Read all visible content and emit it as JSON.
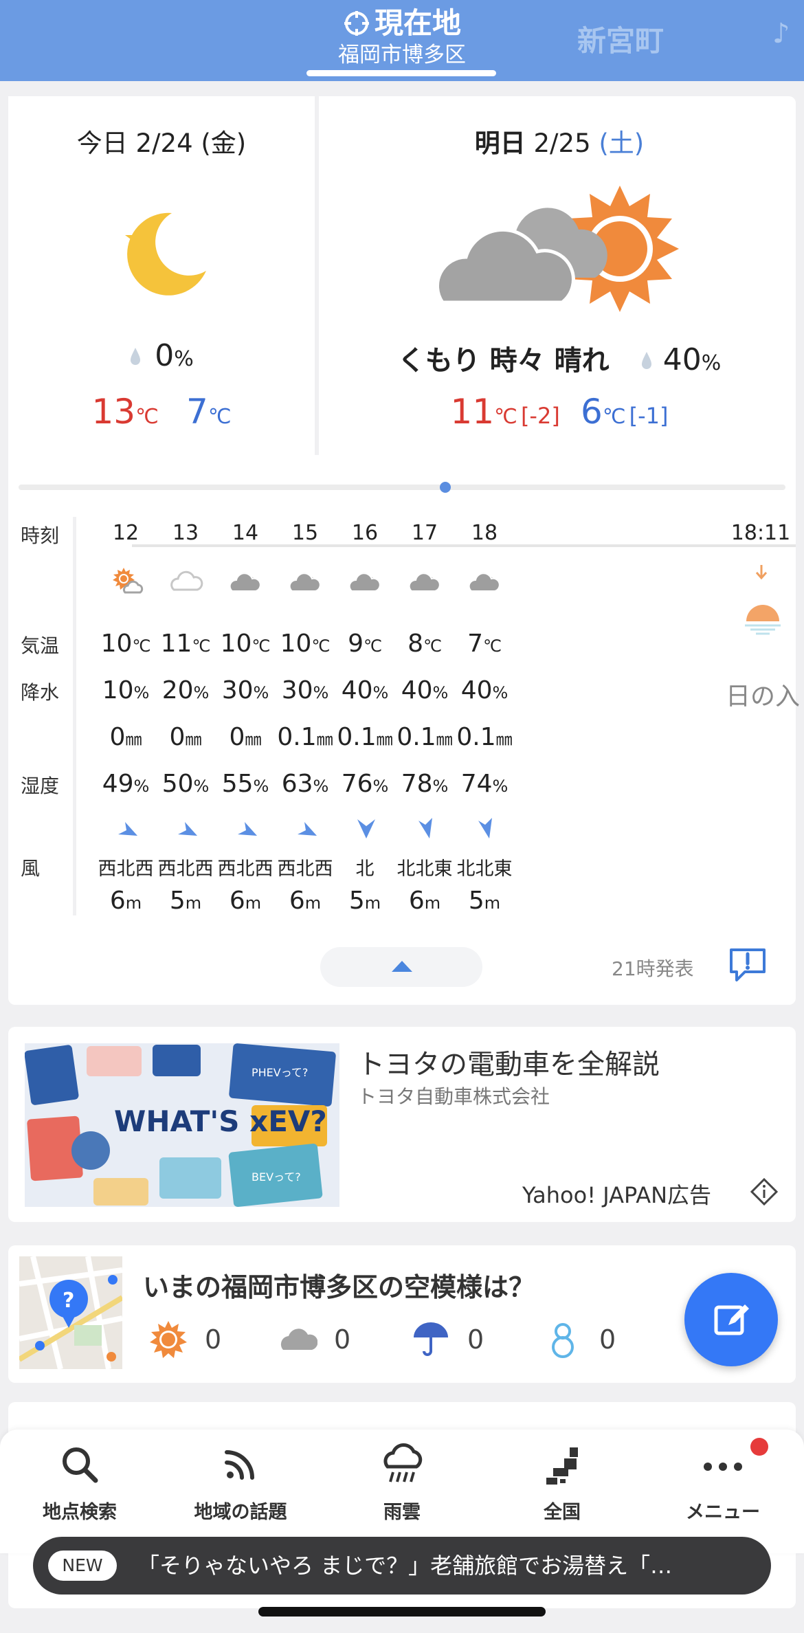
{
  "header": {
    "current_location_title": "現在地",
    "current_location_sub": "福岡市博多区",
    "other_location": "新宮町",
    "partial_tab": "♪"
  },
  "today": {
    "label": "今日",
    "date": "2/24",
    "weekday": "(金)",
    "icon": "moon-star-icon",
    "precip": "0",
    "precip_unit": "%",
    "high": "13",
    "low": "7",
    "temp_unit": "℃"
  },
  "tomorrow": {
    "label": "明日",
    "date": "2/25",
    "weekday": "(土)",
    "icon": "cloud-sun-icon",
    "weather_text": "くもり 時々 晴れ",
    "precip": "40",
    "precip_unit": "%",
    "high": "11",
    "high_diff": "[-2]",
    "low": "6",
    "low_diff": "[-1]",
    "temp_unit": "℃"
  },
  "hourly": {
    "labels": {
      "time": "時刻",
      "temp": "気温",
      "precip": "降水",
      "humidity": "湿度",
      "wind": "風"
    },
    "hours": [
      {
        "hour": "12",
        "icon": "sun-cloud-icon",
        "temp": "10",
        "prob": "10",
        "mm": "0",
        "hum": "49",
        "dir": "西北西",
        "spd": "6"
      },
      {
        "hour": "13",
        "icon": "light-cloud-icon",
        "temp": "11",
        "prob": "20",
        "mm": "0",
        "hum": "50",
        "dir": "西北西",
        "spd": "5"
      },
      {
        "hour": "14",
        "icon": "cloud-icon",
        "temp": "10",
        "prob": "30",
        "mm": "0",
        "hum": "55",
        "dir": "西北西",
        "spd": "6"
      },
      {
        "hour": "15",
        "icon": "cloud-icon",
        "temp": "10",
        "prob": "30",
        "mm": "0.1",
        "hum": "63",
        "dir": "西北西",
        "spd": "6"
      },
      {
        "hour": "16",
        "icon": "cloud-icon",
        "temp": "9",
        "prob": "40",
        "mm": "0.1",
        "hum": "76",
        "dir": "北",
        "spd": "5"
      },
      {
        "hour": "17",
        "icon": "cloud-icon",
        "temp": "8",
        "prob": "40",
        "mm": "0.1",
        "hum": "78",
        "dir": "北北東",
        "spd": "6"
      },
      {
        "hour": "18",
        "icon": "cloud-icon",
        "temp": "7",
        "prob": "40",
        "mm": "0.1",
        "hum": "74",
        "dir": "北北東",
        "spd": "5"
      }
    ],
    "units": {
      "temp": "℃",
      "prob": "%",
      "mm": "㎜",
      "hum": "%",
      "spd": "m"
    },
    "sunset": {
      "time": "18:11",
      "label": "日の入"
    },
    "issued": "21時発表"
  },
  "ad": {
    "title": "トヨタの電動車を全解説",
    "advertiser": "トヨタ自動車株式会社",
    "label": "Yahoo! JAPAN広告",
    "image_headline": "WHAT'S xEV?",
    "image_tag1": "PHEVって?",
    "image_tag2": "BEVって?"
  },
  "sky": {
    "title": "いまの福岡市博多区の空模様は？",
    "votes": {
      "sunny": "0",
      "cloudy": "0",
      "rainy": "0",
      "snowy": "0"
    }
  },
  "nav": {
    "items": [
      "地点検索",
      "地域の話題",
      "雨雲",
      "全国",
      "メニュー"
    ]
  },
  "news": {
    "badge": "NEW",
    "text": "「そりゃないやろ まじで？」老舗旅館でお湯替え「…"
  },
  "colors": {
    "header_blue": "#6b9be3",
    "high_red": "#d93a32",
    "low_blue": "#3c6fd3",
    "accent": "#3478f6"
  }
}
